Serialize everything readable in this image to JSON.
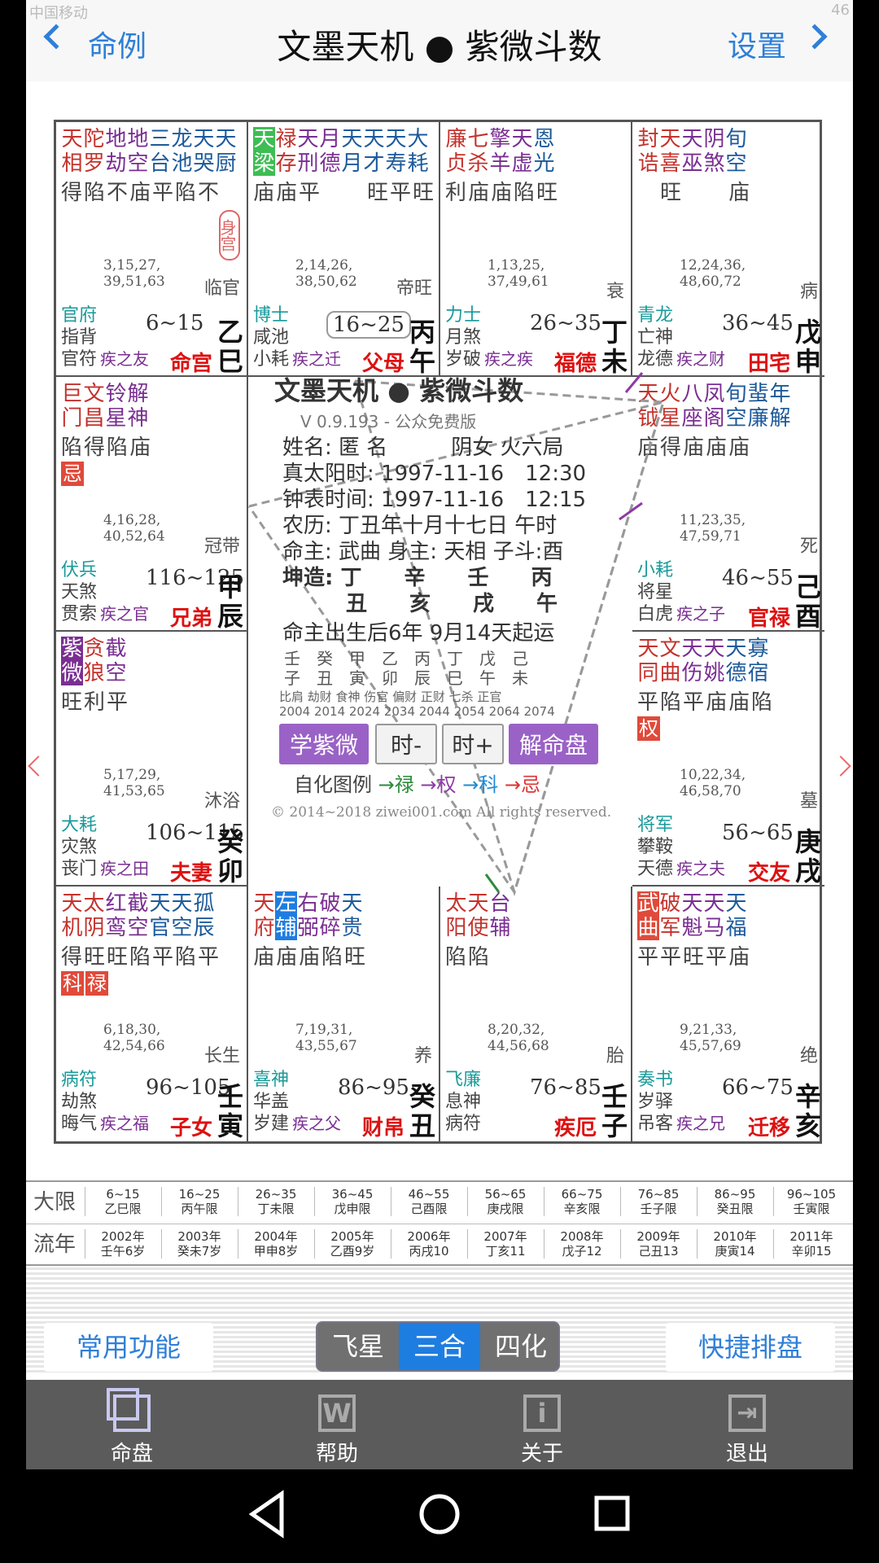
{
  "status": {
    "left": "中国移动",
    "right": "46"
  },
  "header": {
    "back_label": "命例",
    "title": "文墨天机 ● 紫微斗数",
    "settings_label": "设置"
  },
  "palaces": [
    {
      "id": "si",
      "top": [
        "天",
        "陀",
        "地",
        "地",
        "三",
        "龙",
        "天",
        "天"
      ],
      "bot": [
        "相",
        "罗",
        "劫",
        "空",
        "台",
        "池",
        "哭",
        "厨"
      ],
      "bright": "得陷不庙平陷不",
      "years": [
        "3,15,27,",
        "39,51,63"
      ],
      "phase": "临官",
      "g1": "官府",
      "g2": "指背",
      "g3": "官符",
      "sub": "疾之友",
      "daxian": "6~15",
      "stem": "乙",
      "branch": "巳",
      "name": "命宫",
      "shen": "身宫"
    },
    {
      "id": "wu",
      "top": [
        "天",
        "禄",
        "天",
        "月",
        "天",
        "天",
        "天",
        "大"
      ],
      "bot": [
        "梁",
        "存",
        "刑",
        "德",
        "月",
        "才",
        "寿",
        "耗"
      ],
      "bright": "庙庙平　　旺平旺",
      "years": [
        "2,14,26,",
        "38,50,62"
      ],
      "phase": "帝旺",
      "g1": "博士",
      "g2": "咸池",
      "g3": "小耗",
      "sub": "疾之迁",
      "daxian": "16~25",
      "stem": "丙",
      "branch": "午",
      "name": "父母"
    },
    {
      "id": "wei",
      "top": [
        "廉",
        "七",
        "擎",
        "天",
        "恩"
      ],
      "bot": [
        "贞",
        "杀",
        "羊",
        "虚",
        "光"
      ],
      "bright": "利庙庙陷旺",
      "years": [
        "1,13,25,",
        "37,49,61"
      ],
      "phase": "衰",
      "g1": "力士",
      "g2": "月煞",
      "g3": "岁破",
      "sub": "疾之疾",
      "daxian": "26~35",
      "stem": "丁",
      "branch": "未",
      "name": "福德"
    },
    {
      "id": "shen",
      "top": [
        "封",
        "天",
        "天",
        "阴",
        "旬"
      ],
      "bot": [
        "诰",
        "喜",
        "巫",
        "煞",
        "空"
      ],
      "bright": "　旺　　庙",
      "years": [
        "12,24,36,",
        "48,60,72"
      ],
      "phase": "病",
      "g1": "青龙",
      "g2": "亡神",
      "g3": "龙德",
      "sub": "疾之财",
      "daxian": "36~45",
      "stem": "戊",
      "branch": "申",
      "name": "田宅"
    },
    {
      "id": "chen",
      "top": [
        "巨",
        "文",
        "铃",
        "解"
      ],
      "bot": [
        "门",
        "昌",
        "星",
        "神"
      ],
      "bright": "陷得陷庙",
      "tags": [
        "忌"
      ],
      "years": [
        "4,16,28,",
        "40,52,64"
      ],
      "phase": "冠带",
      "g1": "伏兵",
      "g2": "天煞",
      "g3": "贯索",
      "sub": "疾之官",
      "daxian": "116~125",
      "stem": "甲",
      "branch": "辰",
      "name": "兄弟"
    },
    {
      "id": "you",
      "top": [
        "天",
        "火",
        "八",
        "凤",
        "旬",
        "蜚",
        "年"
      ],
      "bot": [
        "钺",
        "星",
        "座",
        "阁",
        "空",
        "廉",
        "解"
      ],
      "bright": "庙得庙庙庙",
      "years": [
        "11,23,35,",
        "47,59,71"
      ],
      "phase": "死",
      "g1": "小耗",
      "g2": "将星",
      "g3": "白虎",
      "sub": "疾之子",
      "daxian": "46~55",
      "stem": "己",
      "branch": "酉",
      "name": "官禄"
    },
    {
      "id": "mao",
      "top": [
        "紫",
        "贪",
        "截"
      ],
      "bot": [
        "微",
        "狼",
        "空"
      ],
      "bright": "旺利平",
      "years": [
        "5,17,29,",
        "41,53,65"
      ],
      "phase": "沐浴",
      "g1": "大耗",
      "g2": "灾煞",
      "g3": "丧门",
      "sub": "疾之田",
      "daxian": "106~115",
      "stem": "癸",
      "branch": "卯",
      "name": "夫妻"
    },
    {
      "id": "xu",
      "top": [
        "天",
        "文",
        "天",
        "天",
        "天",
        "寡"
      ],
      "bot": [
        "同",
        "曲",
        "伤",
        "姚",
        "德",
        "宿"
      ],
      "bright": "平陷平庙庙陷",
      "tags": [
        "权"
      ],
      "years": [
        "10,22,34,",
        "46,58,70"
      ],
      "phase": "墓",
      "g1": "将军",
      "g2": "攀鞍",
      "g3": "天德",
      "sub": "疾之夫",
      "daxian": "56~65",
      "stem": "庚",
      "branch": "戌",
      "name": "交友"
    },
    {
      "id": "yin",
      "top": [
        "天",
        "太",
        "红",
        "截",
        "天",
        "天",
        "孤"
      ],
      "bot": [
        "机",
        "阴",
        "鸾",
        "空",
        "官",
        "空",
        "辰"
      ],
      "bright": "得旺旺陷平陷平",
      "tags": [
        "科",
        "禄"
      ],
      "years": [
        "6,18,30,",
        "42,54,66"
      ],
      "phase": "长生",
      "g1": "病符",
      "g2": "劫煞",
      "g3": "晦气",
      "sub": "疾之福",
      "daxian": "96~105",
      "stem": "壬",
      "branch": "寅",
      "name": "子女"
    },
    {
      "id": "chou",
      "top": [
        "天",
        "左",
        "右",
        "破",
        "天"
      ],
      "bot": [
        "府",
        "辅",
        "弼",
        "碎",
        "贵"
      ],
      "bright": "庙庙庙陷旺",
      "years": [
        "7,19,31,",
        "43,55,67"
      ],
      "phase": "养",
      "g1": "喜神",
      "g2": "华盖",
      "g3": "岁建",
      "sub": "疾之父",
      "daxian": "86~95",
      "stem": "癸",
      "branch": "丑",
      "name": "财帛"
    },
    {
      "id": "zi",
      "top": [
        "太",
        "天",
        "台"
      ],
      "bot": [
        "阳",
        "使",
        "辅"
      ],
      "bright": "陷陷",
      "years": [
        "8,20,32,",
        "44,56,68"
      ],
      "phase": "胎",
      "g1": "飞廉",
      "g2": "息神",
      "g3": "病符",
      "sub": "",
      "daxian": "76~85",
      "stem": "壬",
      "branch": "子",
      "name": "疾厄"
    },
    {
      "id": "hai",
      "top": [
        "武",
        "破",
        "天",
        "天",
        "天"
      ],
      "bot": [
        "曲",
        "军",
        "魁",
        "马",
        "福"
      ],
      "bright": "平平旺平庙",
      "years": [
        "9,21,33,",
        "45,57,69"
      ],
      "phase": "绝",
      "g1": "奏书",
      "g2": "岁驿",
      "g3": "吊客",
      "sub": "疾之兄",
      "daxian": "66~75",
      "stem": "辛",
      "branch": "亥",
      "name": "迁移"
    }
  ],
  "center": {
    "title": "文墨天机 ● 紫微斗数",
    "version": "V 0.9.193 - 公众免费版",
    "line1": "姓名: 匿 名　　　阴女 火六局",
    "line2": "真太阳时: 1997-11-16　12:30",
    "line3": "钟表时间: 1997-11-16　12:15",
    "line4": "农历: 丁丑年十月十七日 午时",
    "line5": "命主: 武曲 身主: 天相 子斗:酉",
    "line6": "坤造:  丁　　辛　　壬　　丙",
    "line7": "　　　丑　　亥　　戌　　午",
    "line8": "命主出生后6年 9月14天起运",
    "dy_gan": "壬　癸　甲　乙　丙　丁　戊　己",
    "dy_zhi": "子　丑　寅　卯　辰　巳　午　未",
    "dy_god": "比肩 劫财 食神 伤官 偏财 正财 七杀 正官",
    "dy_year": "2004 2014 2024 2034 2044 2054 2064 2074",
    "btn_learn": "学紫微",
    "btn_minus": "时-",
    "btn_plus": "时+",
    "btn_explain": "解命盘",
    "legend_label": "自化图例",
    "legend_lu": "→禄",
    "legend_quan": "→权",
    "legend_ke": "→科",
    "legend_ji": "→忌",
    "copyright": "© 2014~2018 ziwei001.com All rights reserved."
  },
  "table": {
    "row1_label": "大限",
    "row2_label": "流年",
    "daxian": [
      [
        "6~15",
        "乙巳限"
      ],
      [
        "16~25",
        "丙午限"
      ],
      [
        "26~35",
        "丁未限"
      ],
      [
        "36~45",
        "戊申限"
      ],
      [
        "46~55",
        "己酉限"
      ],
      [
        "56~65",
        "庚戌限"
      ],
      [
        "66~75",
        "辛亥限"
      ],
      [
        "76~85",
        "壬子限"
      ],
      [
        "86~95",
        "癸丑限"
      ],
      [
        "96~105",
        "壬寅限"
      ]
    ],
    "liunian": [
      [
        "2002年",
        "壬午6岁"
      ],
      [
        "2003年",
        "癸未7岁"
      ],
      [
        "2004年",
        "甲申8岁"
      ],
      [
        "2005年",
        "乙酉9岁"
      ],
      [
        "2006年",
        "丙戌10"
      ],
      [
        "2007年",
        "丁亥11"
      ],
      [
        "2008年",
        "戊子12"
      ],
      [
        "2009年",
        "己丑13"
      ],
      [
        "2010年",
        "庚寅14"
      ],
      [
        "2011年",
        "辛卯15"
      ]
    ]
  },
  "controls": {
    "common": "常用功能",
    "seg": [
      "飞星",
      "三合",
      "四化"
    ],
    "quick": "快捷排盘"
  },
  "nav": [
    {
      "label": "命盘",
      "icon": "pages-icon"
    },
    {
      "label": "帮助",
      "icon": "w-icon"
    },
    {
      "label": "关于",
      "icon": "info-icon"
    },
    {
      "label": "退出",
      "icon": "exit-icon"
    }
  ],
  "colors": {
    "accent": "#2f7fd8",
    "purple_btn": "#9a62c6",
    "red": "#d11",
    "segment_active": "#1e7de0"
  }
}
